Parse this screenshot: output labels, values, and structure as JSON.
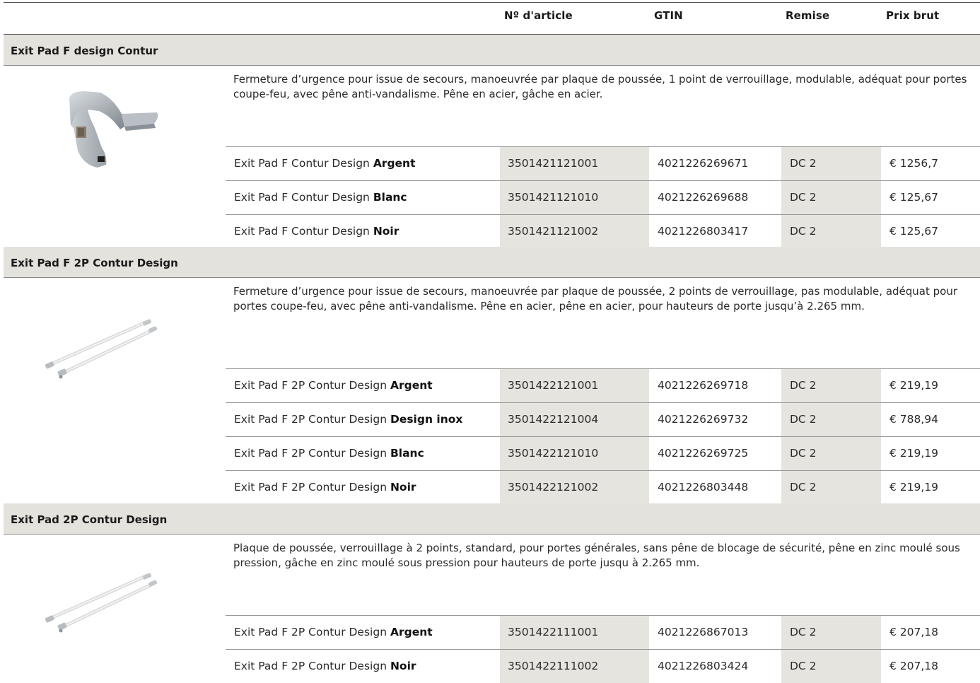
{
  "header": {
    "col_article": "Nº d'article",
    "col_gtin": "GTIN",
    "col_remise": "Remise",
    "col_prix": "Prix brut"
  },
  "sections": [
    {
      "title": "Exit Pad F design Contur",
      "image": "push-pad-lock-image",
      "description": "Fermeture d’urgence pour issue de secours, manoeuvrée par plaque de poussée, 1 point de verrouillage, modulable, adéquat pour portes coupe-feu, avec pêne anti-vandalisme. Pêne en acier, gâche en acier.",
      "rows": [
        {
          "name": "Exit Pad F Contur Design ",
          "variant": "Argent",
          "article": "3501421121001",
          "gtin": "4021226269671",
          "remise": "DC 2",
          "prix": "€ 1256,7"
        },
        {
          "name": "Exit Pad F Contur Design ",
          "variant": "Blanc",
          "article": "3501421121010",
          "gtin": "4021226269688",
          "remise": "DC 2",
          "prix": "€ 125,67"
        },
        {
          "name": "Exit Pad F Contur Design ",
          "variant": "Noir",
          "article": "3501421121002",
          "gtin": "4021226803417",
          "remise": "DC 2",
          "prix": "€ 125,67"
        }
      ]
    },
    {
      "title": "Exit Pad F 2P Contur Design",
      "image": "rods-image",
      "description": "Fermeture d’urgence pour issue de secours, manoeuvrée par plaque de poussée, 2 points de verrouillage, pas modulable, adéquat pour portes coupe-feu, avec pêne anti-vandalisme. Pêne en acier, pêne en acier, pour hauteurs de porte jusqu’à 2.265 mm.",
      "rows": [
        {
          "name": "Exit Pad F 2P Contur Design ",
          "variant": "Argent",
          "article": "3501422121001",
          "gtin": "4021226269718",
          "remise": "DC 2",
          "prix": "€ 219,19"
        },
        {
          "name": "Exit Pad F 2P Contur Design ",
          "variant": "Design inox",
          "article": "3501422121004",
          "gtin": "4021226269732",
          "remise": "DC 2",
          "prix": "€ 788,94"
        },
        {
          "name": "Exit Pad F 2P Contur Design ",
          "variant": "Blanc",
          "article": "3501422121010",
          "gtin": "4021226269725",
          "remise": "DC 2",
          "prix": "€ 219,19"
        },
        {
          "name": "Exit Pad F 2P Contur Design ",
          "variant": "Noir",
          "article": "3501422121002",
          "gtin": "4021226803448",
          "remise": "DC 2",
          "prix": "€ 219,19"
        }
      ]
    },
    {
      "title": "Exit Pad 2P Contur Design",
      "image": "rods-image",
      "description": "Plaque de poussée, verrouillage à 2 points, standard, pour portes générales, sans pêne de blocage de sécurité, pêne en zinc moulé sous pression, gâche en zinc moulé sous pression pour hauteurs de porte jusqu à 2.265 mm.",
      "rows": [
        {
          "name": "Exit Pad F 2P Contur Design ",
          "variant": "Argent",
          "article": "3501422111001",
          "gtin": "4021226867013",
          "remise": "DC 2",
          "prix": "€ 207,18"
        },
        {
          "name": "Exit Pad F 2P Contur Design ",
          "variant": "Noir",
          "article": "3501422111002",
          "gtin": "4021226803424",
          "remise": "DC 2",
          "prix": "€ 207,18"
        }
      ]
    }
  ]
}
